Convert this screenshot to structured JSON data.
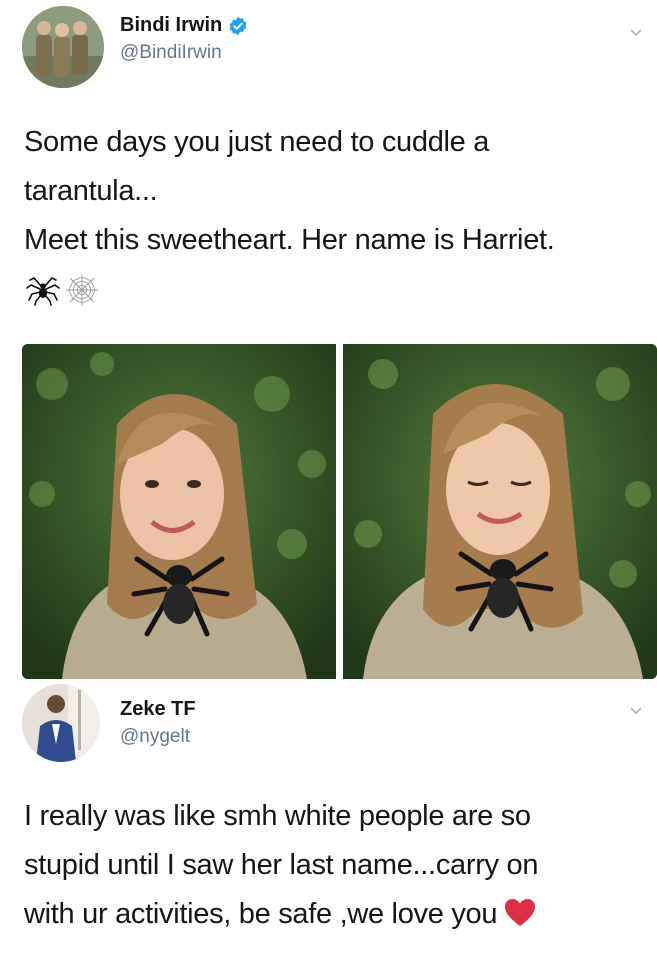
{
  "tweet1": {
    "author_name": "Bindi Irwin",
    "handle": "@BindiIrwin",
    "verified": true,
    "text_lines": [
      "Some days you just need to cuddle a",
      "tarantula...",
      "Meet this sweetheart. Her name is Harriet."
    ],
    "emojis": [
      "spider-emoji",
      "spider-web-emoji"
    ]
  },
  "tweet2": {
    "author_name": "Zeke TF",
    "handle": "@nygelt",
    "text_lines": [
      "I really was like smh white people are so",
      "stupid until I saw her last name...carry on",
      "with ur activities, be safe ,we love you"
    ],
    "emojis": [
      "red-heart-emoji"
    ]
  },
  "colors": {
    "verified_blue": "#1da1f2",
    "handle_gray": "#657786",
    "text_dark": "#14171a",
    "heart_red": "#e0245e"
  }
}
